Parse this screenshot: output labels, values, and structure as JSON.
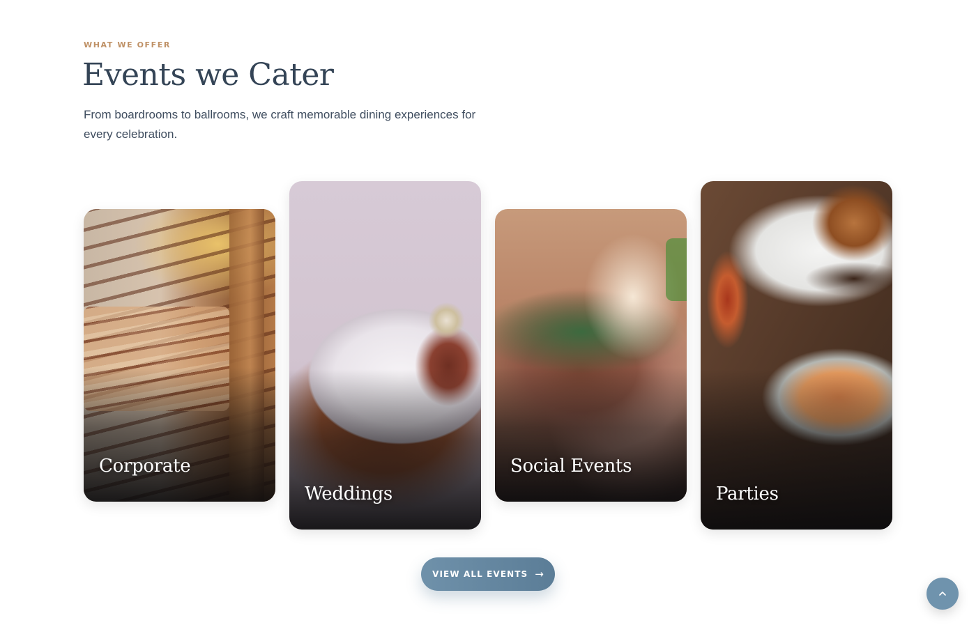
{
  "section": {
    "eyebrow": "WHAT WE OFFER",
    "title": "Events we Cater",
    "intro": "From boardrooms to ballrooms, we craft memorable dining experiences for every celebration."
  },
  "events": [
    {
      "label": "Corporate",
      "image": "buffet trays with grilled sausages"
    },
    {
      "label": "Weddings",
      "image": "plate with cupcake on wooden board"
    },
    {
      "label": "Social Events",
      "image": "hand holding a wine glass"
    },
    {
      "label": "Parties",
      "image": "burger, cocktail glass and casserole dish"
    }
  ],
  "cta": {
    "label": "VIEW ALL EVENTS",
    "arrow": "→"
  },
  "back_to_top": {
    "icon": "chevron-up-icon"
  },
  "colors": {
    "eyebrow": "#bf9166",
    "title": "#344456",
    "button": "#6f91aa",
    "back_to_top": "#6f93ad"
  }
}
